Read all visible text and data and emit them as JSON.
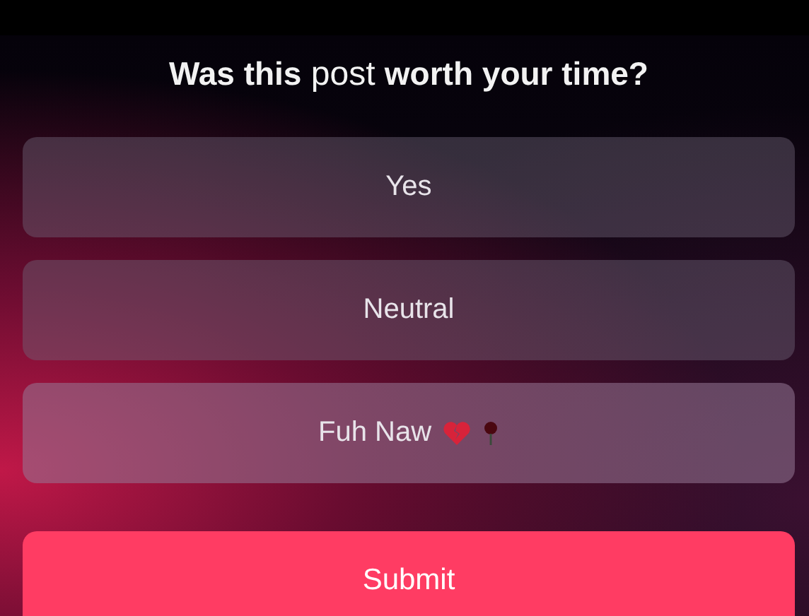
{
  "question": "**Was this** post **worth your time?**",
  "options": [
    {
      "label": "Yes",
      "selected": false,
      "icons": false
    },
    {
      "label": "Neutral",
      "selected": false,
      "icons": false
    },
    {
      "label": "Fuh Naw",
      "selected": true,
      "icons": true
    }
  ],
  "submit": "Submit"
}
